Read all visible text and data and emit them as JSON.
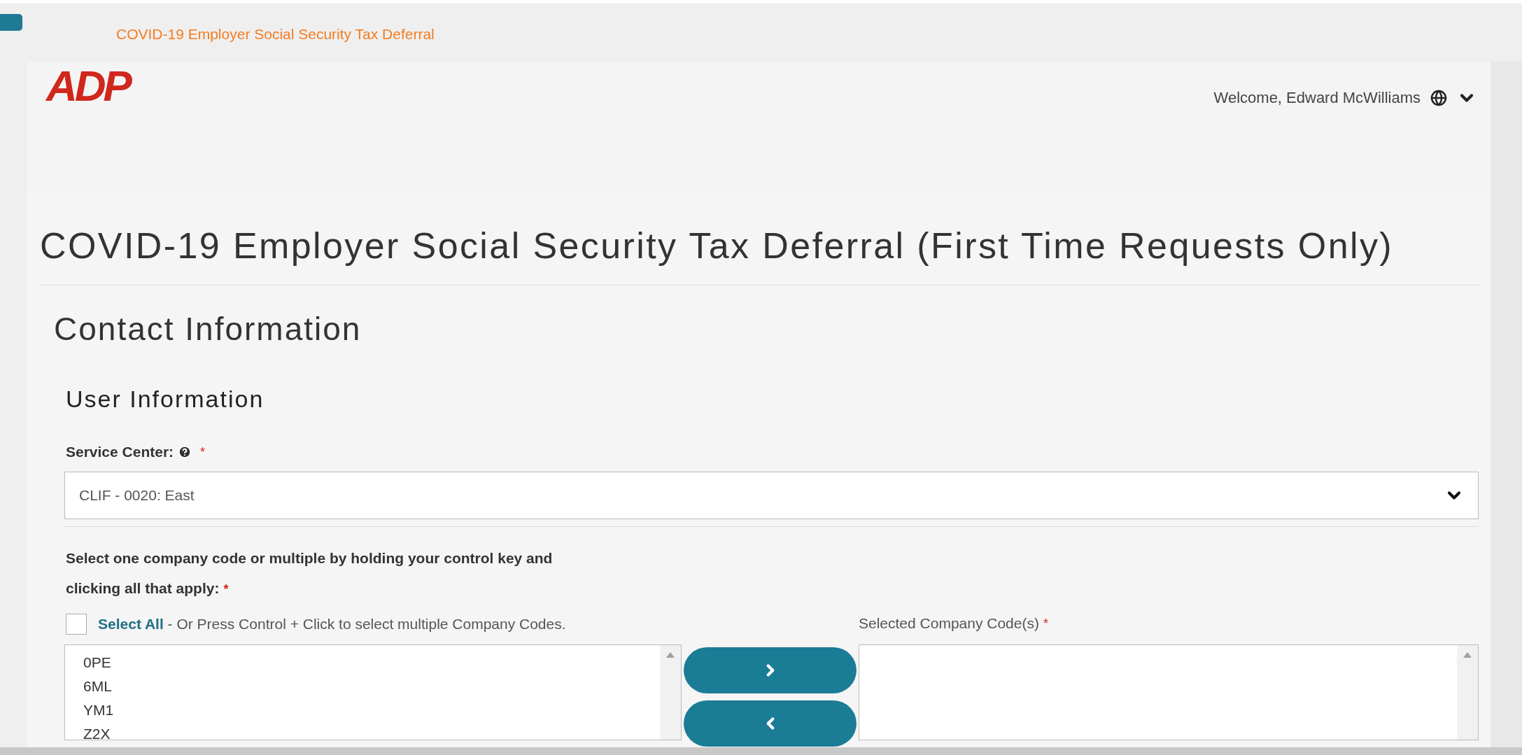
{
  "browser_tab": {
    "label": "COVID-19 Employer Social Security Tax Deferral"
  },
  "header": {
    "logo": "ADP",
    "welcome": "Welcome, Edward McWilliams"
  },
  "page_title": "COVID-19 Employer Social Security Tax Deferral (First Time Requests Only)",
  "section_title": "Contact Information",
  "subsection_title": "User Information",
  "service_center": {
    "label": "Service Center:",
    "required_mark": "*",
    "value": "CLIF - 0020: East"
  },
  "company_codes": {
    "instruction": "Select one company code or multiple by holding your control key and clicking all that apply:",
    "required_mark": "*",
    "select_all": {
      "checked": false,
      "link": "Select All",
      "hint": "- Or Press Control + Click to select multiple Company Codes."
    },
    "available": [
      {
        "code": "0PE",
        "selected": false
      },
      {
        "code": "6ML",
        "selected": false
      },
      {
        "code": "YM1",
        "selected": false
      },
      {
        "code": "Z2X",
        "selected": false
      }
    ],
    "selected_label": "Selected Company Code(s)",
    "selected_required_mark": "*"
  }
}
